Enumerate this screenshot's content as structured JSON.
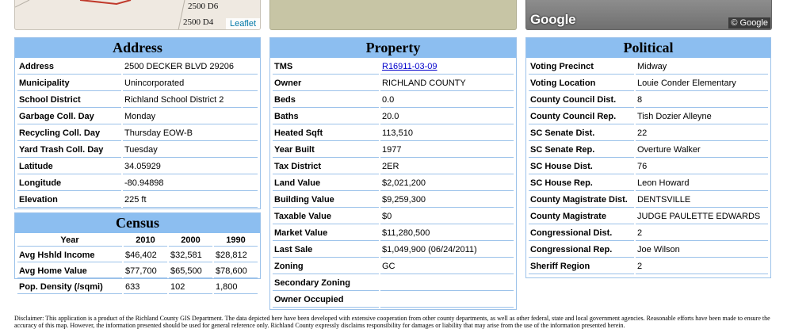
{
  "map": {
    "label_d6": "2500 D6",
    "label_d4": "2500 D4",
    "attribution": "Leaflet",
    "colors": {
      "parcel_line": "#c0392b",
      "road": "#b7b0a6"
    }
  },
  "streetview": {
    "logo": "Google",
    "copyright": "© Google"
  },
  "address": {
    "title": "Address",
    "rows": [
      {
        "label": "Address",
        "value": "2500 DECKER BLVD 29206"
      },
      {
        "label": "Municipality",
        "value": "Unincorporated"
      },
      {
        "label": "School District",
        "value": "Richland School District 2"
      },
      {
        "label": "Garbage Coll. Day",
        "value": "Monday"
      },
      {
        "label": "Recycling Coll. Day",
        "value": "Thursday EOW-B"
      },
      {
        "label": "Yard Trash Coll. Day",
        "value": "Tuesday"
      },
      {
        "label": "Latitude",
        "value": "34.05929"
      },
      {
        "label": "Longitude",
        "value": "-80.94898"
      },
      {
        "label": "Elevation",
        "value": "225 ft"
      }
    ]
  },
  "census": {
    "title": "Census",
    "headers": [
      "Year",
      "2010",
      "2000",
      "1990"
    ],
    "rows": [
      {
        "label": "Avg Hshld Income",
        "values": [
          "$46,402",
          "$32,581",
          "$28,812"
        ]
      },
      {
        "label": "Avg Home Value",
        "values": [
          "$77,700",
          "$65,500",
          "$78,600"
        ]
      },
      {
        "label": "Pop. Density (/sqmi)",
        "values": [
          "633",
          "102",
          "1,800"
        ]
      }
    ]
  },
  "property": {
    "title": "Property",
    "rows": [
      {
        "label": "TMS",
        "value": "R16911-03-09"
      },
      {
        "label": "Owner",
        "value": "RICHLAND COUNTY"
      },
      {
        "label": "Beds",
        "value": "0.0"
      },
      {
        "label": "Baths",
        "value": "20.0"
      },
      {
        "label": "Heated Sqft",
        "value": "113,510"
      },
      {
        "label": "Year Built",
        "value": "1977"
      },
      {
        "label": "Tax District",
        "value": "2ER"
      },
      {
        "label": "Land Value",
        "value": "$2,021,200"
      },
      {
        "label": "Building Value",
        "value": "$9,259,300"
      },
      {
        "label": "Taxable Value",
        "value": "$0"
      },
      {
        "label": "Market Value",
        "value": "$11,280,500"
      },
      {
        "label": "Last Sale",
        "value": "$1,049,900 (06/24/2011)"
      },
      {
        "label": "Zoning",
        "value": "GC"
      },
      {
        "label": "Secondary Zoning",
        "value": ""
      },
      {
        "label": "Owner Occupied",
        "value": ""
      }
    ]
  },
  "political": {
    "title": "Political",
    "rows": [
      {
        "label": "Voting Precinct",
        "value": "Midway"
      },
      {
        "label": "Voting Location",
        "value": "Louie Conder Elementary"
      },
      {
        "label": "County Council Dist.",
        "value": "8"
      },
      {
        "label": "County Council Rep.",
        "value": "Tish Dozier Alleyne"
      },
      {
        "label": "SC Senate Dist.",
        "value": "22"
      },
      {
        "label": "SC Senate Rep.",
        "value": "Overture Walker"
      },
      {
        "label": "SC House Dist.",
        "value": "76"
      },
      {
        "label": "SC House Rep.",
        "value": "Leon Howard"
      },
      {
        "label": "County Magistrate Dist.",
        "value": "DENTSVILLE"
      },
      {
        "label": "County Magistrate",
        "value": "JUDGE PAULETTE EDWARDS"
      },
      {
        "label": "Congressional Dist.",
        "value": "2"
      },
      {
        "label": "Congressional Rep.",
        "value": "Joe Wilson"
      },
      {
        "label": "Sheriff Region",
        "value": "2"
      }
    ]
  },
  "disclaimer": "Disclaimer: This application is a product of the Richland County GIS Department. The data depicted here have been developed with extensive cooperation from other county departments, as well as other federal, state and local government agencies. Reasonable efforts have been made to ensure the accuracy of this map. However, the information presented should be used for general reference only. Richland County expressly disclaims responsibility for damages or liability that may arise from the use of the information presented herein."
}
